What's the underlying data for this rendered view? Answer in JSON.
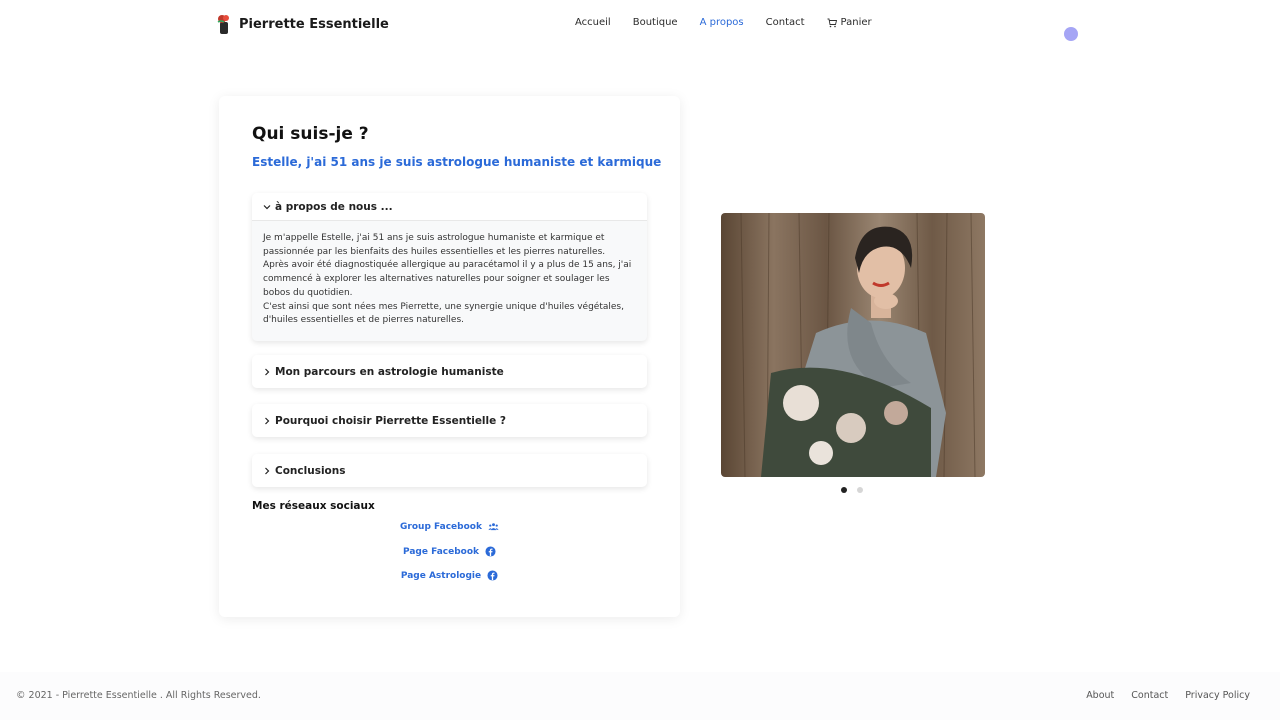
{
  "brand": {
    "name": "Pierrette Essentielle",
    "logo_icon": "rose-bottle-logo-icon"
  },
  "nav": {
    "items": [
      {
        "label": "Accueil"
      },
      {
        "label": "Boutique"
      },
      {
        "label": "A propos",
        "active": true
      },
      {
        "label": "Contact"
      },
      {
        "label": "Panier",
        "icon": "cart-icon"
      }
    ]
  },
  "colors": {
    "accent": "#2b6ad8",
    "dot": "#a5a5f5"
  },
  "card": {
    "title": "Qui suis-je ?",
    "subtitle": "Estelle, j'ai 51 ans je suis astrologue humaniste et karmique",
    "accordion": [
      {
        "label": "à propos de nous ...",
        "expanded": true,
        "body": [
          "Je m'appelle Estelle, j'ai 51 ans je suis astrologue humaniste et karmique et passionnée par les bienfaits des huiles essentielles et les pierres naturelles.",
          "Après avoir été diagnostiquée allergique au paracétamol il y a plus de 15 ans, j'ai commencé à explorer les alternatives naturelles pour soigner et soulager les bobos du quotidien.",
          "C'est ainsi que sont nées mes Pierrette, une synergie unique d'huiles végétales, d'huiles essentielles et de pierres naturelles."
        ]
      },
      {
        "label": "Mon parcours en astrologie humaniste",
        "expanded": false
      },
      {
        "label": "Pourquoi choisir Pierrette Essentielle ?",
        "expanded": false
      },
      {
        "label": "Conclusions",
        "expanded": false
      }
    ],
    "social": {
      "title": "Mes réseaux sociaux",
      "links": [
        {
          "label": "Group Facebook",
          "icon": "group-icon"
        },
        {
          "label": "Page Facebook",
          "icon": "facebook-icon"
        },
        {
          "label": "Page Astrologie",
          "icon": "facebook-icon"
        }
      ]
    }
  },
  "carousel": {
    "slides": 2,
    "active_index": 0
  },
  "footer": {
    "copyright": "© 2021 - Pierrette Essentielle . All Rights Reserved.",
    "links": [
      {
        "label": "About"
      },
      {
        "label": "Contact"
      },
      {
        "label": "Privacy Policy"
      }
    ]
  }
}
